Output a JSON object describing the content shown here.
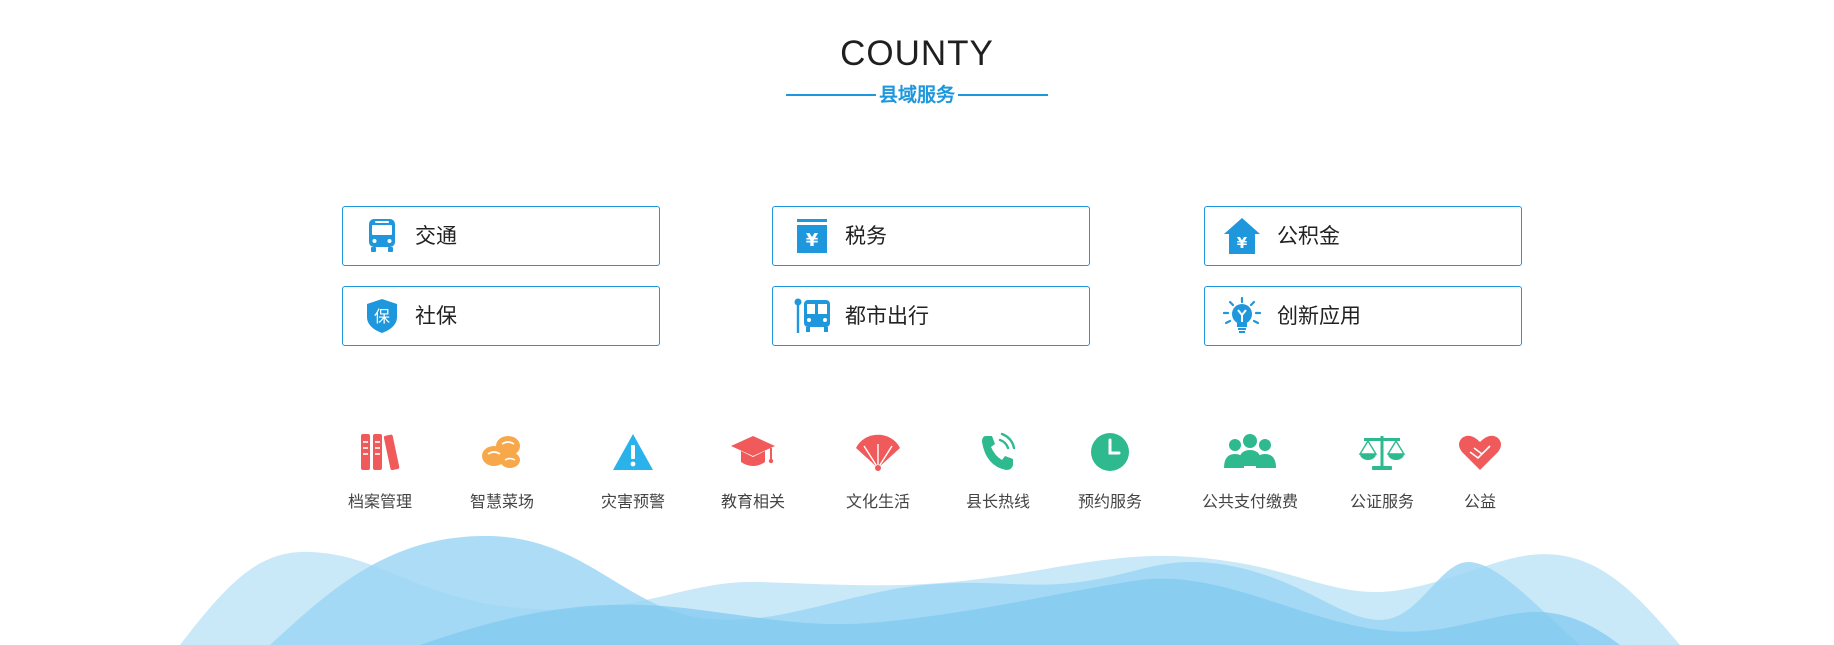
{
  "header": {
    "title_en": "COUNTY",
    "title_cn": "县域服务"
  },
  "cards": [
    {
      "label": "交通",
      "icon": "bus-icon"
    },
    {
      "label": "税务",
      "icon": "tax-yuan-icon"
    },
    {
      "label": "公积金",
      "icon": "house-yuan-icon"
    },
    {
      "label": "社保",
      "icon": "shield-bao-icon"
    },
    {
      "label": "都市出行",
      "icon": "bus-stop-icon"
    },
    {
      "label": "创新应用",
      "icon": "lightbulb-icon"
    }
  ],
  "icon_glyphs": {
    "social_security": "保",
    "yuan": "¥"
  },
  "services": [
    {
      "label": "档案管理",
      "icon": "archive-books-icon"
    },
    {
      "label": "智慧菜场",
      "icon": "peanut-icon"
    },
    {
      "label": "灾害预警",
      "icon": "warning-icon"
    },
    {
      "label": "教育相关",
      "icon": "graduation-cap-icon"
    },
    {
      "label": "文化生活",
      "icon": "fan-icon"
    },
    {
      "label": "县长热线",
      "icon": "phone-icon"
    },
    {
      "label": "预约服务",
      "icon": "clock-icon"
    },
    {
      "label": "公共支付缴费",
      "icon": "group-icon"
    },
    {
      "label": "公证服务",
      "icon": "scales-icon"
    },
    {
      "label": "公益",
      "icon": "heart-hands-icon"
    }
  ],
  "colors": {
    "accent": "#1e97dc",
    "icon_red": "#f15a5a",
    "icon_orange": "#f7a84a",
    "icon_sky": "#29b3ea",
    "icon_green": "#2eb98f",
    "wave_light": "#c9e8f8",
    "wave_mid": "#9ed6f4",
    "wave_dark": "#7ec8ef"
  }
}
